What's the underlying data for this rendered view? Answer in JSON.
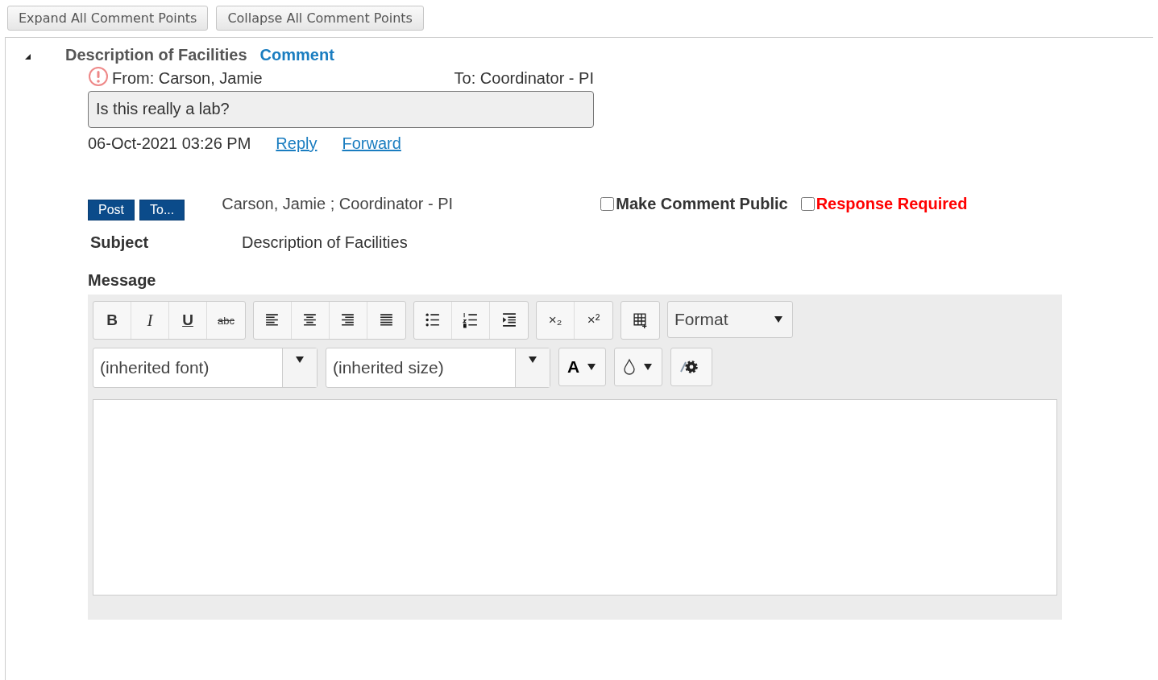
{
  "top_buttons": [
    "Expand All Comment Points",
    "Collapse All Comment Points"
  ],
  "comment_point": {
    "expanded": true,
    "title": "Description of Facilities",
    "label": "Comment",
    "comments": [
      {
        "important": true,
        "from": "From: Carson, Jamie",
        "to": "To: Coordinator - PI",
        "message": "Is this really a lab?",
        "date": "06-Oct-2021 03:26 PM",
        "links": [
          "Reply",
          "Forward"
        ]
      }
    ]
  },
  "compose": {
    "post_button": "Post",
    "to_button": "To...",
    "recipients": "Carson, Jamie ; Coordinator - PI",
    "options": [
      {
        "kind": "normal",
        "label": "Make Comment Public",
        "checked": false
      },
      {
        "kind": "required",
        "label": "Response Required",
        "checked": false
      }
    ],
    "subject_label": "Subject",
    "subject": "Description of Facilities",
    "message_label": "Message",
    "editor": {
      "groups": [
        [
          {
            "kind": "bold",
            "label": "B"
          },
          {
            "kind": "italic",
            "label": "I"
          },
          {
            "kind": "underline",
            "label": "U"
          },
          {
            "kind": "strike",
            "label": "abc"
          }
        ],
        [
          {
            "kind": "align-left"
          },
          {
            "kind": "align-center"
          },
          {
            "kind": "align-right"
          },
          {
            "kind": "justify"
          }
        ],
        [
          {
            "kind": "bullets"
          },
          {
            "kind": "numbers"
          },
          {
            "kind": "indent"
          }
        ],
        [
          {
            "kind": "subscript",
            "label": "×₂"
          },
          {
            "kind": "superscript",
            "label": "×²"
          }
        ],
        [
          {
            "kind": "table"
          }
        ]
      ],
      "format": "Format",
      "font": "(inherited font)",
      "size": "(inherited size)",
      "text_color": "A"
    }
  }
}
